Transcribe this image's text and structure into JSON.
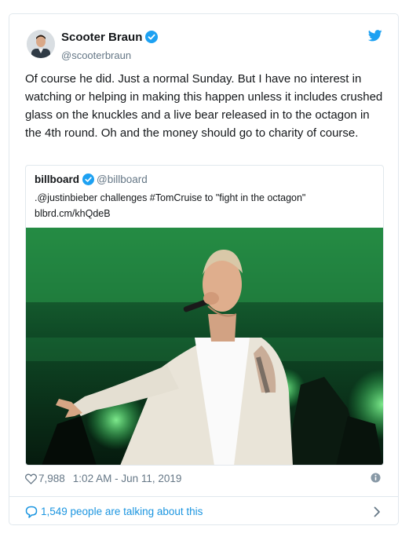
{
  "tweet": {
    "display_name": "Scooter Braun",
    "handle": "@scooterbraun",
    "text": "Of course he did. Just a normal Sunday. But I have no interest in watching or helping in making this happen unless it includes crushed glass on the knuckles and a live bear released in to the octagon in the 4th round. Oh and the money should go to charity of course.",
    "likes": "7,988",
    "timestamp": "1:02 AM - Jun 11, 2019",
    "talking": "1,549 people are talking about this"
  },
  "quoted": {
    "name": "billboard",
    "handle": "@billboard",
    "text": ".@justinbieber challenges #TomCruise to \"fight in the octagon\"",
    "link": "blbrd.cm/khQdeB"
  },
  "colors": {
    "brand": "#1da1f2",
    "link": "#1b95e0",
    "muted": "#657786",
    "border": "#e1e8ed"
  },
  "icons": [
    "verified-badge-icon",
    "twitter-bird-icon",
    "heart-icon",
    "info-icon",
    "speech-bubble-icon",
    "chevron-right-icon"
  ]
}
